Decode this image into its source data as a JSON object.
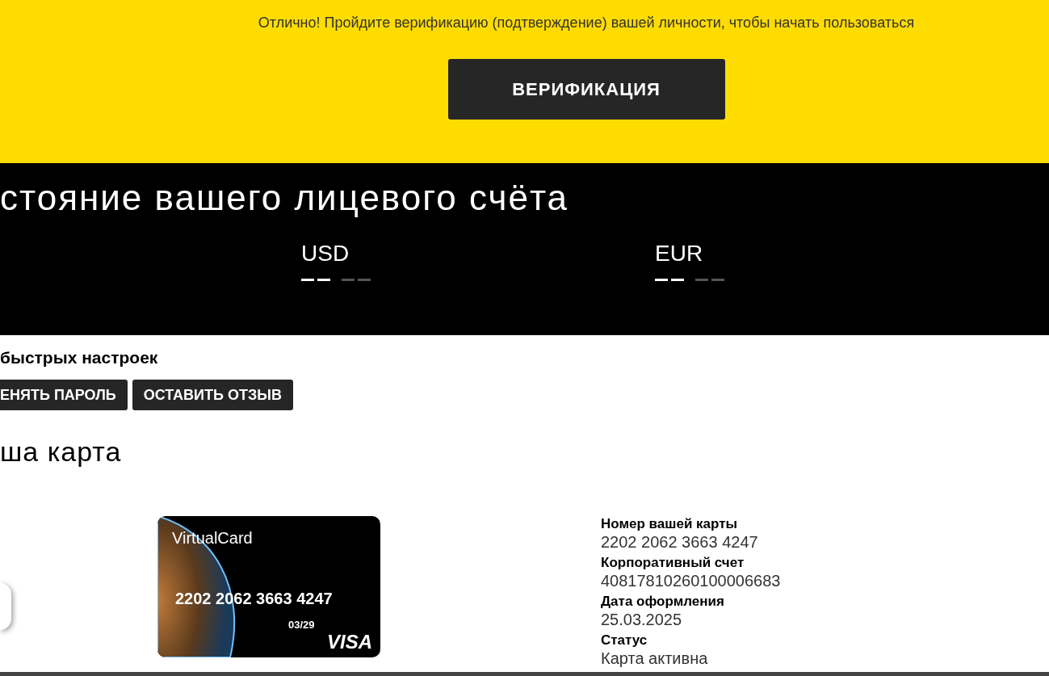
{
  "verification_banner": {
    "message": "Отлично! Пройдите верификацию (подтверждение) вашей личности, чтобы начать пользоваться",
    "button": "ВЕРИФИКАЦИЯ"
  },
  "account": {
    "title": "стояние вашего лицевого счёта",
    "balances": [
      {
        "currency": "USD"
      },
      {
        "currency": "EUR"
      }
    ]
  },
  "quick_settings": {
    "title": "быстрых настроек",
    "buttons": [
      "ЕНЯТЬ ПАРОЛЬ",
      "ОСТАВИТЬ ОТЗЫВ"
    ]
  },
  "card_section": {
    "title": "ша карта",
    "card": {
      "brand_text": "VirtualCard",
      "number": "2202 2062 3663 4247",
      "expiry": "03/29",
      "network": "VISA"
    },
    "details": [
      {
        "label": "Номер вашей карты",
        "value": "2202 2062 3663 4247"
      },
      {
        "label": "Корпоративный счет",
        "value": "40817810260100006683"
      },
      {
        "label": "Дата оформления",
        "value": "25.03.2025"
      },
      {
        "label": "Статус",
        "value": "Карта активна"
      }
    ]
  }
}
